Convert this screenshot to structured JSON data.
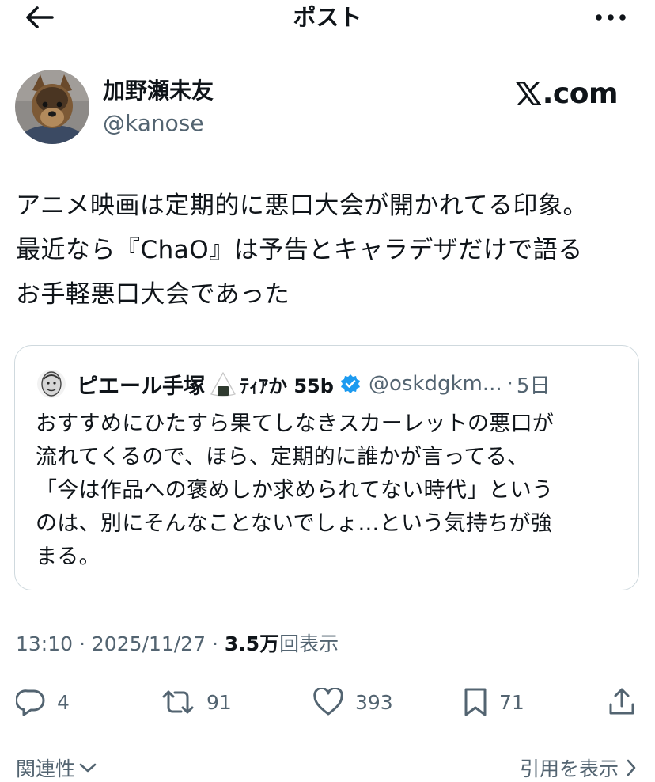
{
  "header": {
    "title": "ポスト"
  },
  "author": {
    "display_name": "加野瀬未友",
    "handle": "@kanose"
  },
  "brand": {
    "logo_text": ".com",
    "logo_icon": "x-logo-icon"
  },
  "post": {
    "text": "アニメ映画は定期的に悪口大会が開かれてる印象。\n最近なら『ChaO』は予告とキャラデザだけで語る\nお手軽悪口大会であった"
  },
  "quote": {
    "display_name": "ピエール手塚",
    "name_suffix": "ﾃｨｱか 55b",
    "handle": "@oskdgkm...",
    "separator": "·",
    "age": "5日",
    "text": "おすすめにひたすら果てしなきスカーレットの悪口が\n流れてくるので、ほら、定期的に誰かが言ってる、\n「今は作品への褒めしか求められてない時代」という\nのは、別にそんなことないでしょ…という気持ちが強\nまる。"
  },
  "meta": {
    "time": "13:10",
    "date": "2025/11/27",
    "separator": "·",
    "views_count": "3.5万",
    "views_label": "回表示"
  },
  "actions": {
    "replies": "4",
    "retweets": "91",
    "likes": "393",
    "bookmarks": "71"
  },
  "footer": {
    "related_label": "関連性",
    "quotes_label": "引用を表示"
  },
  "colors": {
    "text": "#0f1419",
    "muted": "#536471",
    "border": "#cfd9de",
    "verified": "#1d9bf0"
  }
}
